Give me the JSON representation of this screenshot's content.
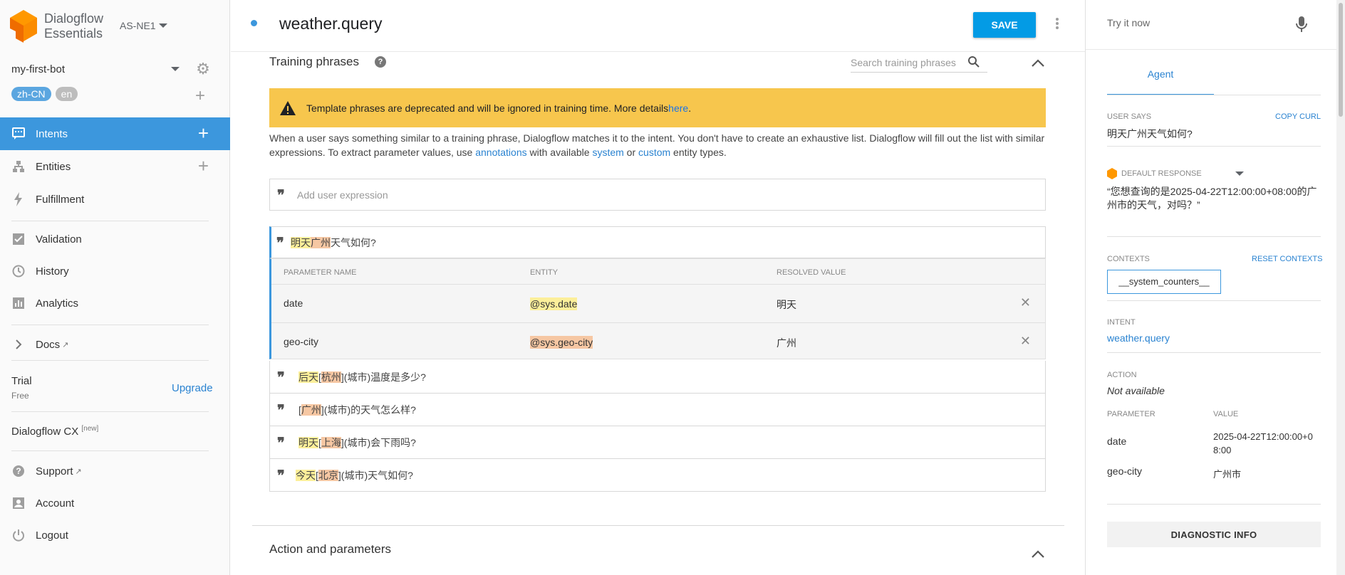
{
  "brand": {
    "name_line1": "Dialogflow",
    "name_line2": "Essentials",
    "region": "AS-NE1"
  },
  "agent": {
    "name": "my-first-bot",
    "languages": [
      "zh-CN",
      "en"
    ]
  },
  "sidebar": {
    "items": [
      {
        "label": "Intents"
      },
      {
        "label": "Entities"
      },
      {
        "label": "Fulfillment"
      },
      {
        "label": "Validation"
      },
      {
        "label": "History"
      },
      {
        "label": "Analytics"
      },
      {
        "label": "Docs"
      }
    ],
    "trial_label": "Trial",
    "trial_sub": "Free",
    "upgrade": "Upgrade",
    "cx_label": "Dialogflow CX",
    "cx_badge": "[new]",
    "bottom": [
      {
        "label": "Support"
      },
      {
        "label": "Account"
      },
      {
        "label": "Logout"
      }
    ]
  },
  "header": {
    "title": "weather.query",
    "save_label": "SAVE"
  },
  "training": {
    "title": "Training phrases",
    "search_placeholder": "Search training phrases",
    "banner_text": "Template phrases are deprecated and will be ignored in training time. More details ",
    "banner_link": "here",
    "banner_end": ".",
    "desc_1": "When a user says something similar to a training phrase, Dialogflow matches it to the intent. You don't have to create an exhaustive list. Dialogflow will fill out the list with similar expressions. To extract parameter values, use ",
    "desc_link1": "annotations",
    "desc_2": " with available ",
    "desc_link2": "system",
    "desc_3": " or ",
    "desc_link3": "custom",
    "desc_4": " entity types.",
    "add_placeholder": "Add user expression",
    "active_phrase": {
      "part1": "明天",
      "part2": "广州",
      "part3": "天气如何?"
    },
    "table_headers": {
      "name": "PARAMETER NAME",
      "entity": "ENTITY",
      "resolved": "RESOLVED VALUE"
    },
    "params": [
      {
        "name": "date",
        "entity": "@sys.date",
        "resolved": "明天"
      },
      {
        "name": "geo-city",
        "entity": "@sys.geo-city",
        "resolved": "广州"
      }
    ],
    "phrases": [
      {
        "a": "后天",
        "b": "[",
        "c": "杭州",
        "d": "](城市)温度是多少?"
      },
      {
        "a": "",
        "b": "[",
        "c": "广州",
        "d": "](城市)的天气怎么样?"
      },
      {
        "a": "明天",
        "b": "[",
        "c": "上海",
        "d": "](城市)会下雨吗?"
      },
      {
        "a": "今天",
        "b": "[",
        "c": "北京",
        "d": "](城市)天气如何?"
      }
    ]
  },
  "action_section": {
    "title": "Action and parameters"
  },
  "try_panel": {
    "placeholder": "Try it now",
    "tab": "Agent",
    "user_says_label": "USER SAYS",
    "copy_curl": "COPY CURL",
    "user_says": "明天广州天气如何?",
    "default_response_label": "DEFAULT RESPONSE",
    "default_response": "“您想查询的是2025-04-22T12:00:00+08:00的广州市的天气，对吗？”",
    "contexts_label": "CONTEXTS",
    "reset_contexts": "RESET CONTEXTS",
    "context_chip": "__system_counters__",
    "intent_label": "INTENT",
    "intent_value": "weather.query",
    "action_label": "ACTION",
    "action_value": "Not available",
    "param_header": "PARAMETER",
    "value_header": "VALUE",
    "params": [
      {
        "name": "date",
        "value": "2025-04-22T12:00:00+08:00"
      },
      {
        "name": "geo-city",
        "value": "广州市"
      }
    ],
    "diagnostic": "DIAGNOSTIC INFO"
  },
  "colors": {
    "accent": "#3c97dd",
    "save": "#039be5",
    "banner": "#f7c64d",
    "entity_yellow": "#fcef9a",
    "entity_orange": "#f6c7a3"
  }
}
